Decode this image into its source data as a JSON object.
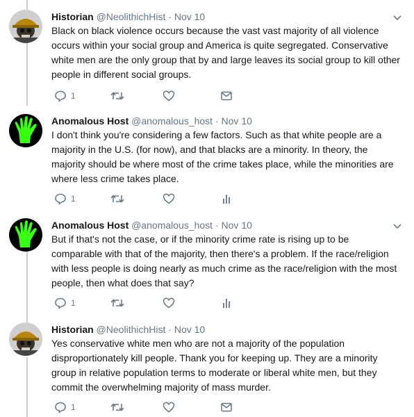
{
  "tweets": [
    {
      "name": "Historian",
      "handle": "@NeolithichHist",
      "dot": "·",
      "date": "Nov 10",
      "text": "Black on black violence occurs because the vast vast majority of all violence occurs within your social group and America is quite segregated. Conservative white men are the only group that by and large leaves its social group to kill other people in different social groups.",
      "reply_count": "1",
      "avatar_icon": "helmet-skull-avatar",
      "extra_icon": "mail-icon"
    },
    {
      "name": "Anomalous Host",
      "handle": "@anomalous_host",
      "dot": "·",
      "date": "Nov 10",
      "text": "I don't think you're considering a few factors.  Such as that white people are a majority in the U.S. (for now), and that blacks are a minority.  In theory, the majority should be where most of the crime takes place, while the minorities are where less crime takes place.",
      "reply_count": "1",
      "avatar_icon": "green-hand-avatar",
      "extra_icon": "analytics-icon"
    },
    {
      "name": "Anomalous Host",
      "handle": "@anomalous_host",
      "dot": "·",
      "date": "Nov 10",
      "text": "But if that's not the case, or if the minority crime rate is rising up to be comparable with that of the majority, then there's a problem.  If the race/religion with less people is doing nearly as much crime as the race/religion with the most people, then what does that say?",
      "reply_count": "1",
      "avatar_icon": "green-hand-avatar",
      "extra_icon": "analytics-icon"
    },
    {
      "name": "Historian",
      "handle": "@NeolithichHist",
      "dot": "·",
      "date": "Nov 10",
      "text": "Yes conservative white men who are not a majority of the population disproportionately kill people. Thank you for keeping up. They are a minority group in relative population terms to moderate or liberal white men, but they commit the overwhelming majority of mass murder.",
      "reply_count": "1",
      "avatar_icon": "helmet-skull-avatar",
      "extra_icon": "mail-icon"
    }
  ],
  "colors": {
    "text": "#14171a",
    "muted": "#657786",
    "thread_line": "#c4cfd6",
    "hand_green": "#39ff14"
  }
}
